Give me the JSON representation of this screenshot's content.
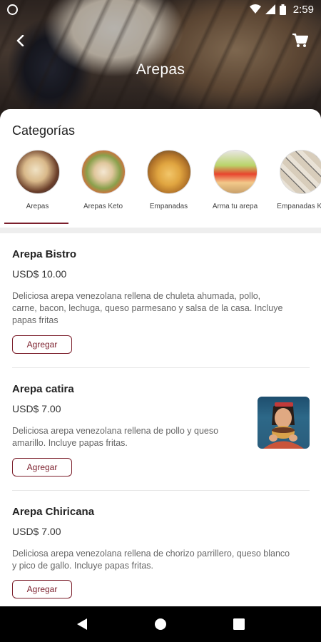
{
  "status_bar": {
    "time": "2:59"
  },
  "header": {
    "title": "Arepas"
  },
  "categories": {
    "heading": "Categorías",
    "items": [
      {
        "label": "Arepas"
      },
      {
        "label": "Arepas Keto"
      },
      {
        "label": "Empanadas"
      },
      {
        "label": "Arma tu arepa"
      },
      {
        "label": "Empanadas Ke"
      }
    ],
    "selected": "Arepas"
  },
  "products": [
    {
      "name": "Arepa Bistro",
      "price": "USD$ 10.00",
      "description": "Deliciosa arepa venezolana rellena de chuleta ahumada, pollo, carne, bacon, lechuga, queso parmesano y salsa de la casa. Incluye papas fritas",
      "button": "Agregar"
    },
    {
      "name": "Arepa catira",
      "price": "USD$ 7.00",
      "description": "Deliciosa arepa venezolana rellena de pollo y queso amarillo. Incluye papas fritas.",
      "button": "Agregar"
    },
    {
      "name": "Arepa Chiricana",
      "price": "USD$ 7.00",
      "description": "Deliciosa arepa venezolana rellena de chorizo parrillero, queso blanco y pico de gallo. Incluye papas fritas.",
      "button": "Agregar"
    }
  ],
  "colors": {
    "accent": "#7b1e2b",
    "nav": "#000000"
  }
}
